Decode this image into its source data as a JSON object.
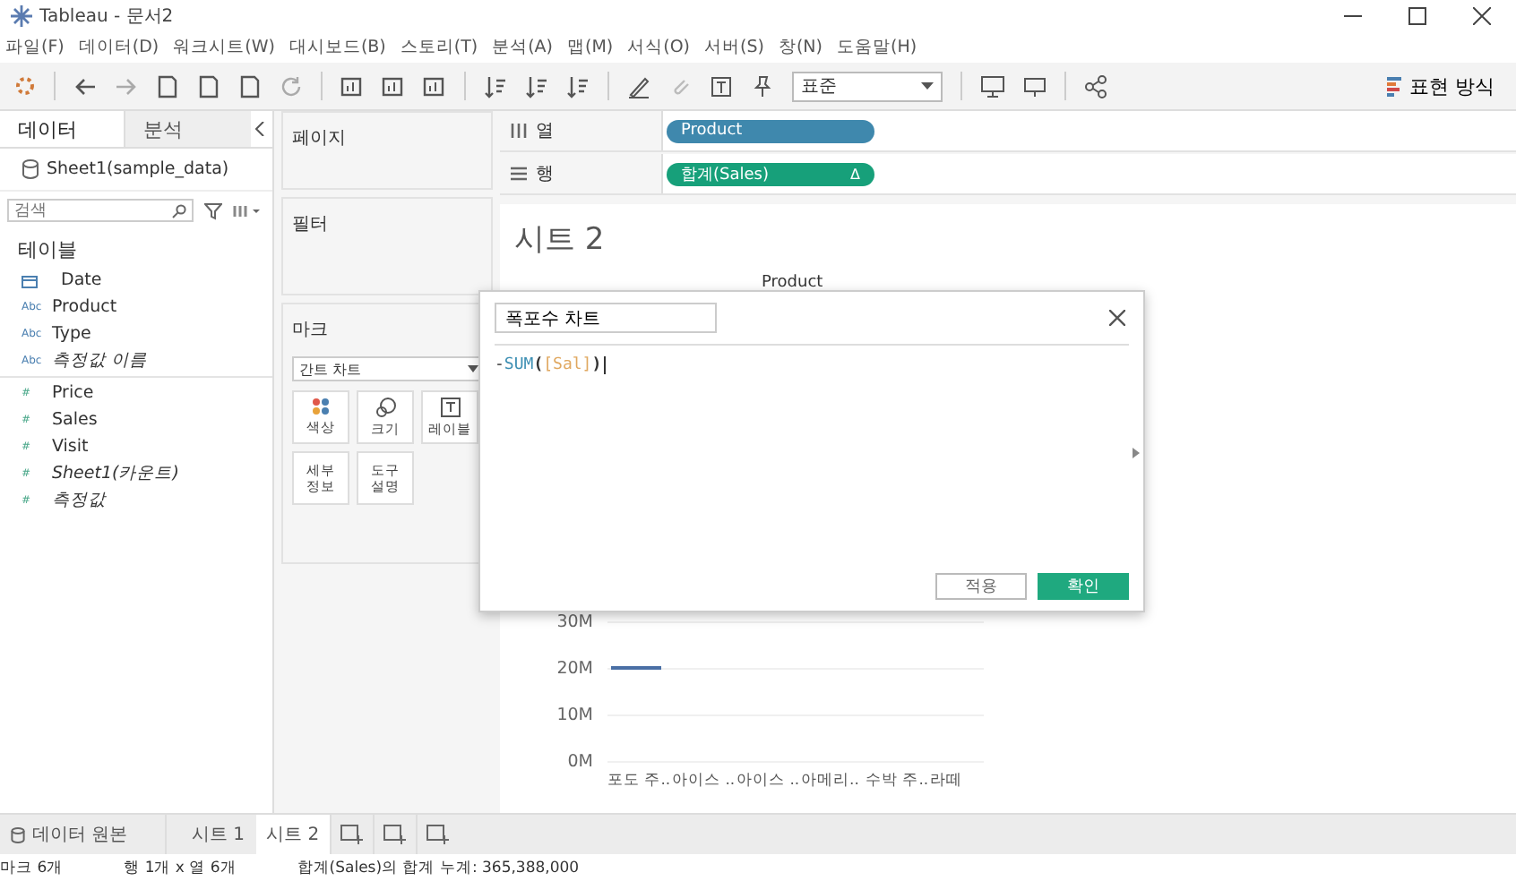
{
  "window": {
    "title": "Tableau - 문서2"
  },
  "menu": [
    "파일(F)",
    "데이터(D)",
    "워크시트(W)",
    "대시보드(B)",
    "스토리(T)",
    "분석(A)",
    "맵(M)",
    "서식(O)",
    "서버(S)",
    "창(N)",
    "도움말(H)"
  ],
  "toolbar": {
    "fit_dropdown": "표준",
    "show_me": "표현 방식"
  },
  "data_pane": {
    "tabs": [
      {
        "label": "데이터",
        "selected": true
      },
      {
        "label": "분석",
        "selected": false
      }
    ],
    "datasource": "Sheet1(sample_data)",
    "search": {
      "placeholder": "검색"
    },
    "section": "테이블",
    "fields": [
      {
        "name": "Date",
        "kind": "date",
        "italic": false
      },
      {
        "name": "Product",
        "kind": "dimension",
        "badge": "Abc",
        "italic": false
      },
      {
        "name": "Type",
        "kind": "dimension",
        "badge": "Abc",
        "italic": false
      },
      {
        "name": "측정값 이름",
        "kind": "dimension",
        "badge": "Abc",
        "italic": true
      },
      {
        "name": "Price",
        "kind": "measure",
        "badge": "#",
        "italic": false
      },
      {
        "name": "Sales",
        "kind": "measure",
        "badge": "#",
        "italic": false
      },
      {
        "name": "Visit",
        "kind": "measure",
        "badge": "#",
        "italic": false
      },
      {
        "name": "Sheet1(카운트)",
        "kind": "measure",
        "badge": "#",
        "italic": true
      },
      {
        "name": "측정값",
        "kind": "measure",
        "badge": "#",
        "italic": true
      }
    ]
  },
  "pages_card": {
    "title": "페이지"
  },
  "filters_card": {
    "title": "필터"
  },
  "marks_card": {
    "title": "마크",
    "mark_type": "간트 차트",
    "buttons": [
      {
        "label": "색상",
        "kind": "color"
      },
      {
        "label": "크기",
        "kind": "size"
      },
      {
        "label": "레이블",
        "kind": "label"
      },
      {
        "label": "세부\n정보",
        "kind": "detail"
      },
      {
        "label": "도구\n설명",
        "kind": "tooltip"
      }
    ]
  },
  "shelves": [
    {
      "label": "열",
      "kind": "columns",
      "pill": {
        "text": "Product",
        "color": "#3f88ad"
      }
    },
    {
      "label": "행",
      "kind": "rows",
      "pill": {
        "text": "합계(Sales)",
        "color": "#17a07a",
        "delta": "Δ"
      }
    }
  ],
  "view": {
    "title": "시트 2",
    "header": "Product",
    "y_ticks": [
      "30M",
      "20M",
      "10M",
      "0M"
    ],
    "categories": [
      "포도 주..",
      "아이스 ..",
      "아이스 ..",
      "아메리..",
      "수박 주..",
      "라떼"
    ]
  },
  "calc_dialog": {
    "name": "폭포수 차트",
    "formula": [
      {
        "text": "-",
        "kind": "op"
      },
      {
        "text": "SUM",
        "kind": "func"
      },
      {
        "text": "(",
        "kind": "paren"
      },
      {
        "text": "[Sal",
        "kind": "field"
      },
      {
        "text": "]",
        "kind": "field"
      },
      {
        "text": ")",
        "kind": "paren"
      }
    ],
    "buttons": [
      {
        "label": "적용",
        "kind": "secondary"
      },
      {
        "label": "확인",
        "kind": "primary"
      }
    ]
  },
  "sheet_tabs": {
    "datasource": "데이터 원본",
    "sheets": [
      {
        "label": "시트 1",
        "selected": false
      },
      {
        "label": "시트 2",
        "selected": true
      }
    ]
  },
  "status_bar": [
    "마크 6개",
    "행 1개 x 열 6개",
    "합계(Sales)의 합계 누계: 365,388,000"
  ]
}
